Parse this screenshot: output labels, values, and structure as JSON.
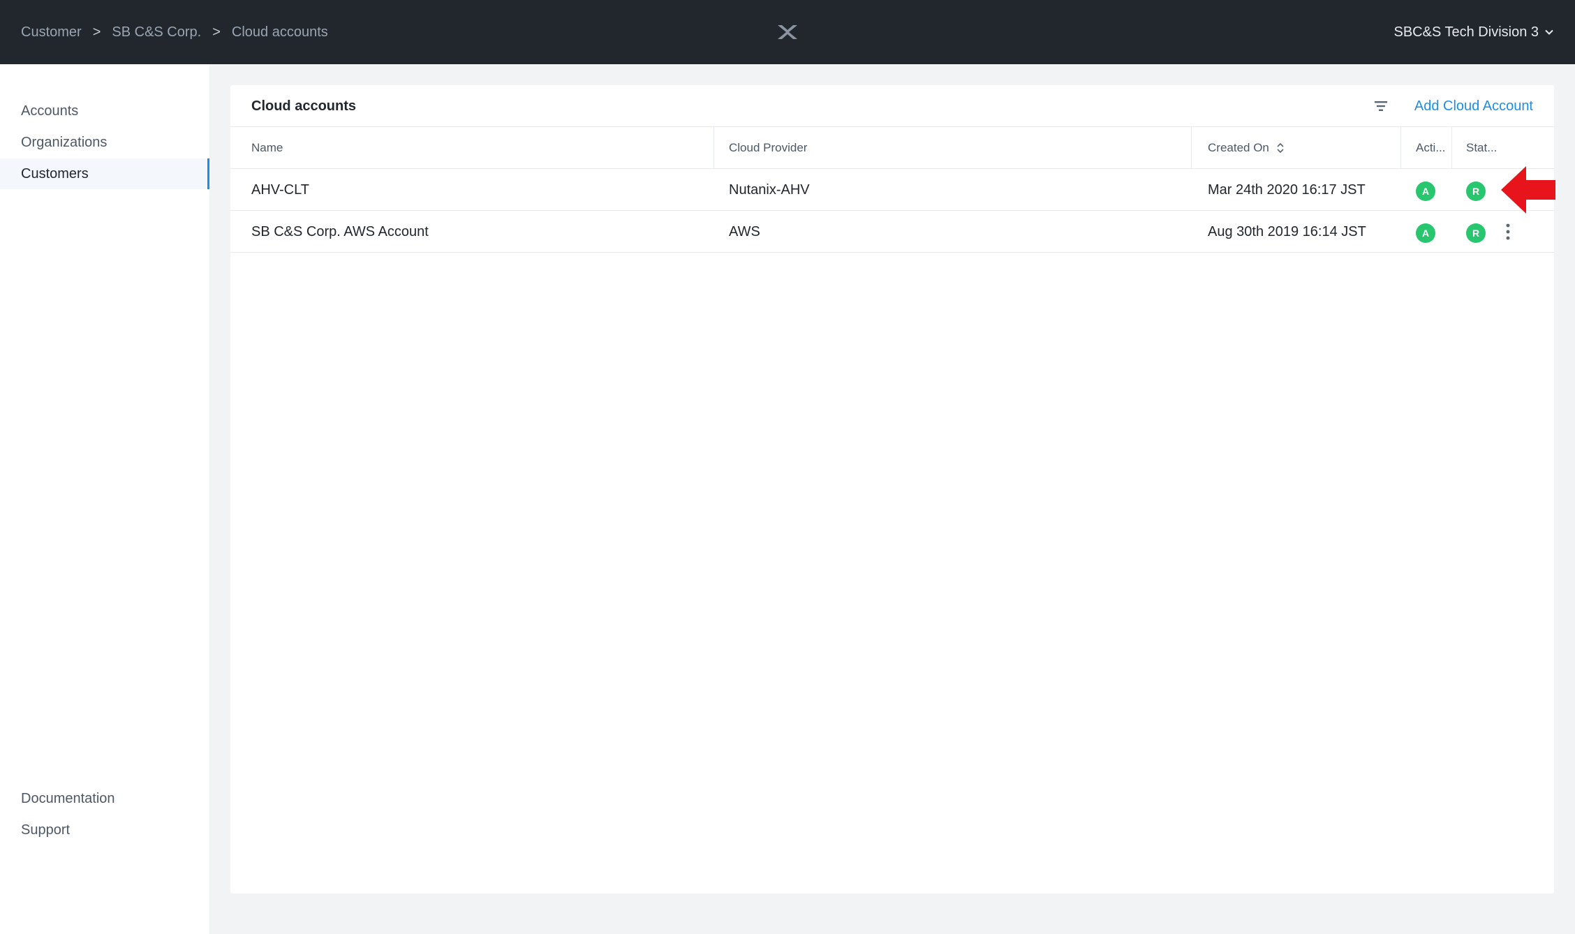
{
  "header": {
    "breadcrumb": [
      "Customer",
      "SB C&S Corp.",
      "Cloud accounts"
    ],
    "breadcrumb_separator": ">",
    "account_name": "SBC&S Tech Division 3",
    "logo_icon": "nutanix-x-logo-icon",
    "account_chevron_icon": "chevron-down-icon"
  },
  "sidebar": {
    "items": [
      {
        "label": "Accounts",
        "active": false
      },
      {
        "label": "Organizations",
        "active": false
      },
      {
        "label": "Customers",
        "active": true
      }
    ],
    "footer_items": [
      {
        "label": "Documentation"
      },
      {
        "label": "Support"
      }
    ]
  },
  "panel": {
    "title": "Cloud accounts",
    "filter_icon": "filter-icon",
    "add_button_label": "Add Cloud Account",
    "columns": [
      "Name",
      "Cloud Provider",
      "Created On",
      "Acti...",
      "Stat..."
    ],
    "rows": [
      {
        "name": "AHV-CLT",
        "provider": "Nutanix-AHV",
        "created_on": "Mar 24th 2020 16:17 JST",
        "active_badge": "A",
        "status_badge": "R",
        "show_menu": false
      },
      {
        "name": "SB C&S Corp. AWS Account",
        "provider": "AWS",
        "created_on": "Aug 30th 2019 16:14 JST",
        "active_badge": "A",
        "status_badge": "R",
        "show_menu": true
      }
    ]
  },
  "colors": {
    "topbar": "#22272e",
    "accent": "#1b8eeb",
    "badge_green": "#28c76f",
    "annotation_arrow": "#e8141c"
  }
}
